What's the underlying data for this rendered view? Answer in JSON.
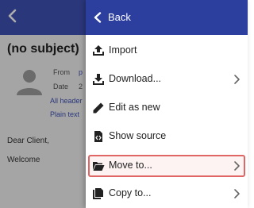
{
  "background": {
    "subject": "(no subject)",
    "from_label": "From",
    "from_value": "p",
    "date_label": "Date",
    "date_value": "2",
    "all_headers_link": "All header",
    "plain_text_link": "Plain text",
    "body_line1": "Dear Client,",
    "body_line2": "Welcome"
  },
  "menu": {
    "back_label": "Back",
    "items": [
      {
        "label": "Import",
        "icon": "upload-icon"
      },
      {
        "label": "Download...",
        "icon": "download-icon",
        "submenu": true
      },
      {
        "label": "Edit as new",
        "icon": "pencil-icon"
      },
      {
        "label": "Show source",
        "icon": "source-file-icon"
      },
      {
        "label": "Move to...",
        "icon": "folder-open-icon",
        "submenu": true,
        "highlighted": true
      },
      {
        "label": "Copy to...",
        "icon": "copy-icon",
        "submenu": true
      }
    ]
  },
  "colors": {
    "header": "#3f51b5",
    "menu_header": "#2c3e9e",
    "highlight_border": "#e06666"
  }
}
